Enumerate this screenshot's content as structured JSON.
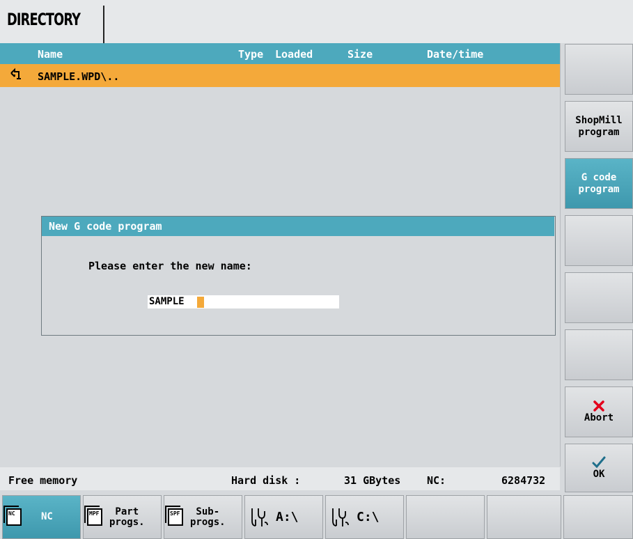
{
  "window": {
    "title": "DIRECTORY"
  },
  "list": {
    "columns": [
      "Name",
      "Type",
      "Loaded",
      "Size",
      "Date/time"
    ],
    "rows": [
      {
        "icon": "folder-up-icon",
        "name": "SAMPLE.WPD\\.."
      }
    ]
  },
  "dialog": {
    "title": "New G code program",
    "prompt": "Please enter the new name:",
    "input_value": "SAMPLE"
  },
  "status": {
    "free_memory_label": "Free memory",
    "hard_disk_label": "Hard disk :",
    "hard_disk_value": "31 GBytes",
    "nc_label": "NC:",
    "nc_value": "6284732"
  },
  "vertical_softkeys": {
    "shopmill_line1": "ShopMill",
    "shopmill_line2": "program",
    "gcode_line1": "G code",
    "gcode_line2": "program",
    "abort_label": "Abort",
    "ok_label": "OK"
  },
  "horizontal_softkeys": {
    "nc_label": "NC",
    "nc_icon_text": "NC",
    "part_line1": "Part",
    "part_line2": "progs.",
    "part_icon_text": "MPF",
    "sub_line1": "Sub-",
    "sub_line2": "progs.",
    "sub_icon_text": "SPF",
    "drive_a_label": "A:\\",
    "drive_c_label": "C:\\"
  },
  "colors": {
    "accent": "#4da9bd",
    "selection": "#f4a93a",
    "abort": "#e3001b",
    "ok": "#1f6f8b"
  }
}
